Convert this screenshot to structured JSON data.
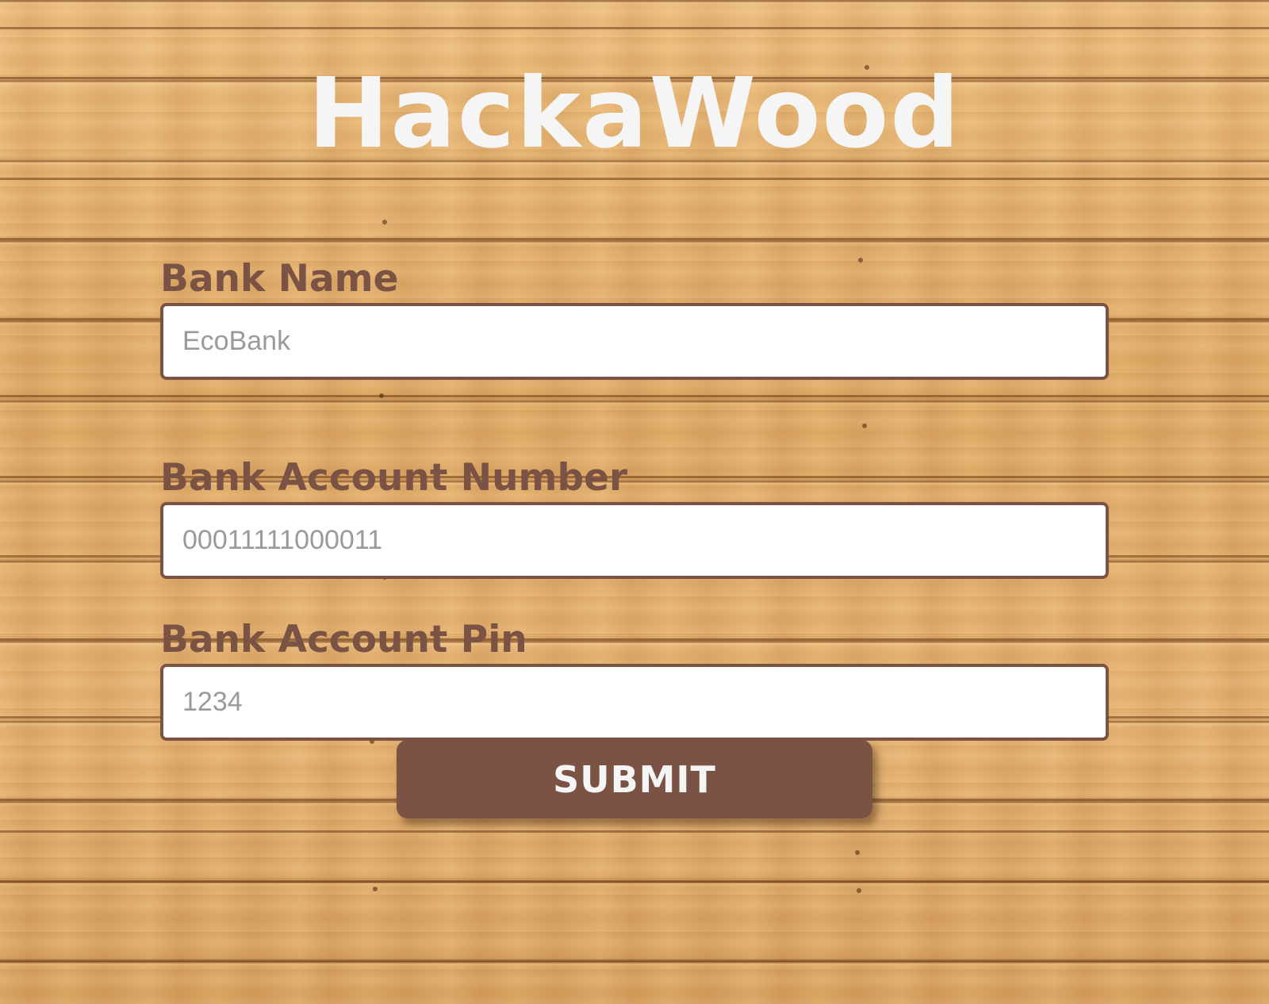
{
  "app": {
    "title": "HackaWood"
  },
  "form": {
    "fields": [
      {
        "label": "Bank Name",
        "placeholder": "EcoBank",
        "value": ""
      },
      {
        "label": "Bank Account Number",
        "placeholder": "00011111000011",
        "value": ""
      },
      {
        "label": "Bank Account Pin",
        "placeholder": "1234",
        "value": ""
      }
    ],
    "submit_label": "SUBMIT"
  },
  "colors": {
    "title": "#f6f5f6",
    "accent": "#7a5344",
    "input_background": "#ffffff",
    "placeholder": "#9a9a9a",
    "wood": "#e0aa68"
  }
}
